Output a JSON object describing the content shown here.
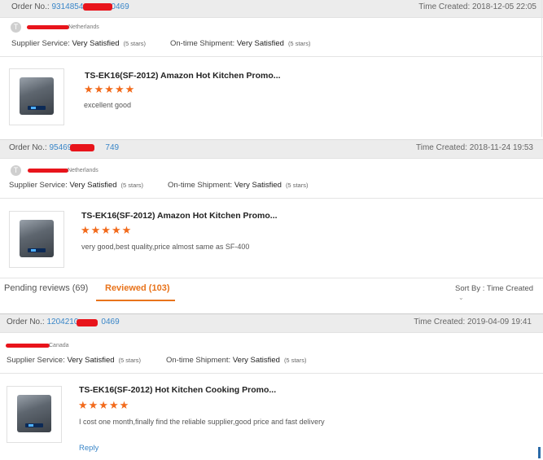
{
  "orders": [
    {
      "label": "Order No.:",
      "number_prefix": "9314854",
      "number_suffix": "0469",
      "time": "Time Created: 2018-12-05 22:05",
      "avatar": "T",
      "country": "Netherlands",
      "supplier_label": "Supplier Service:",
      "supplier_value": "Very Satisfied",
      "supplier_stars": "(5 stars)",
      "shipment_label": "On-time Shipment:",
      "shipment_value": "Very Satisfied",
      "shipment_stars": "(5 stars)",
      "product_title": "TS-EK16(SF-2012) Amazon Hot Kitchen Promo...",
      "stars": "★★★★★",
      "comment": "excellent good"
    },
    {
      "label": "Order No.:",
      "number_prefix": "9546946",
      "number_suffix": "749",
      "time": "Time Created: 2018-11-24 19:53",
      "avatar": "T",
      "country": "Netherlands",
      "supplier_label": "Supplier Service:",
      "supplier_value": "Very Satisfied",
      "supplier_stars": "(5 stars)",
      "shipment_label": "On-time Shipment:",
      "shipment_value": "Very Satisfied",
      "shipment_stars": "(5 stars)",
      "product_title": "TS-EK16(SF-2012) Amazon Hot Kitchen Promo...",
      "stars": "★★★★★",
      "comment": "very good,best quality,price almost same as SF-400"
    },
    {
      "label": "Order No.:",
      "number_prefix": "1204210",
      "number_suffix": "0469",
      "time": "Time Created: 2019-04-09 19:41",
      "country": "Canada",
      "supplier_label": "Supplier Service:",
      "supplier_value": "Very Satisfied",
      "supplier_stars": "(5 stars)",
      "shipment_label": "On-time Shipment:",
      "shipment_value": "Very Satisfied",
      "shipment_stars": "(5 stars)",
      "product_title": "TS-EK16(SF-2012) Hot Kitchen Cooking Promo...",
      "stars": "★★★★★",
      "comment": "I cost one month,finally find the reliable supplier,good price and fast delivery",
      "reply": "Reply"
    }
  ],
  "tabs": {
    "pending": "Pending reviews (69)",
    "reviewed": "Reviewed (103)",
    "sort": "Sort By : Time Created",
    "sort_icon": "chevron-down-icon"
  },
  "colors": {
    "accent": "#e8731b",
    "link": "#3a86c8",
    "star": "#f26a1b",
    "redaction": "#e8141b"
  }
}
